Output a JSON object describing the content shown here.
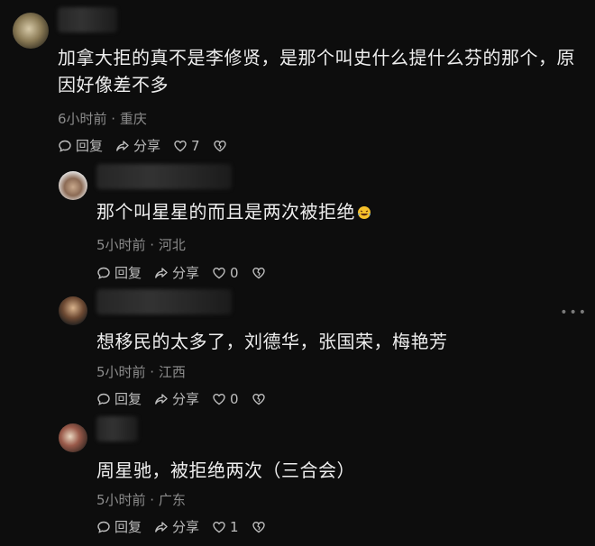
{
  "comments": [
    {
      "text": "加拿大拒的真不是李修贤，是那个叫史什么提什么芬的那个，原因好像差不多",
      "meta": "6小时前 · 重庆",
      "reply": "回复",
      "share": "分享",
      "likes": "7"
    },
    {
      "text": "那个叫星星的而且是两次被拒绝",
      "emoji": "laughing-crying-emoji",
      "meta": "5小时前 · 河北",
      "reply": "回复",
      "share": "分享",
      "likes": "0"
    },
    {
      "text": "想移民的太多了，刘德华，张国荣，梅艳芳",
      "meta": "5小时前 · 江西",
      "reply": "回复",
      "share": "分享",
      "likes": "0"
    },
    {
      "text": "周星驰，被拒绝两次（三合会）",
      "meta": "5小时前 · 广东",
      "reply": "回复",
      "share": "分享",
      "likes": "1"
    }
  ],
  "icons": {
    "reply": "reply-bubble-icon",
    "share": "share-arrow-icon",
    "like": "heart-icon",
    "dislike": "broken-heart-icon",
    "more": "more-dots-icon"
  },
  "colors": {
    "background": "#0d0d0d",
    "text": "#eeeeee",
    "meta": "#8c8c8c",
    "action": "#bdbdbd"
  }
}
